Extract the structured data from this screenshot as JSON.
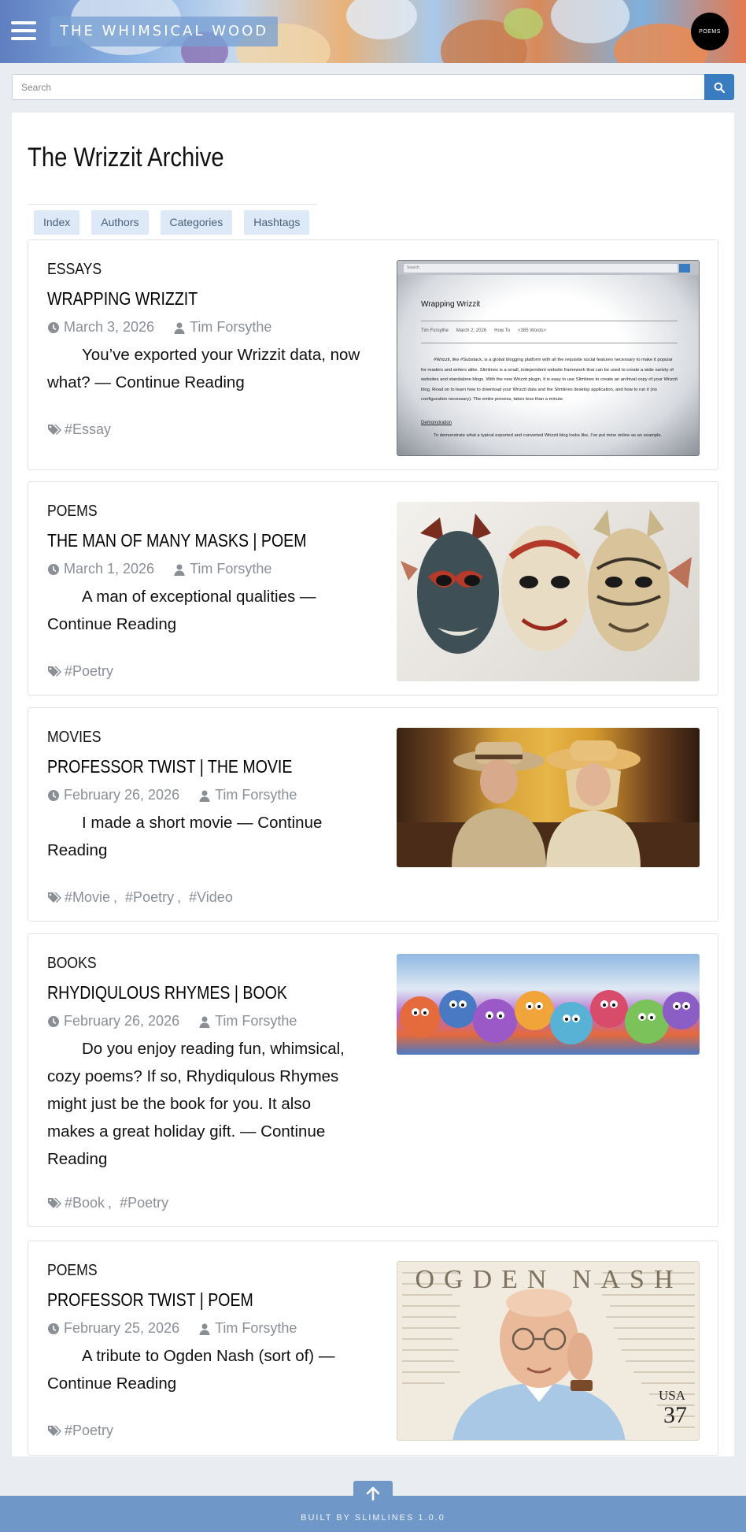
{
  "header": {
    "brand": "THE WHIMSICAL WOOD",
    "poems_button": "POEMS",
    "menu_icon": "hamburger-menu-icon"
  },
  "search": {
    "placeholder": "Search",
    "icon": "search-icon"
  },
  "archive": {
    "title": "The Wrizzit Archive",
    "tabs": [
      "Index",
      "Authors",
      "Categories",
      "Hashtags"
    ]
  },
  "posts": [
    {
      "category": "ESSAYS",
      "title": "WRAPPING WRIZZIT",
      "date": "March 3, 2026",
      "author": "Tim Forsythe",
      "excerpt": "You’ve exported your Wrizzit data, now what? — Continue Reading",
      "tags": [
        "#Essay"
      ],
      "image": {
        "search_placeholder": "Search",
        "title": "Wrapping Wrizzit",
        "meta_author": "Tim Forsythe",
        "meta_date": "March 2, 2026",
        "meta_category": "How To",
        "meta_words": "<385 Words>",
        "body": "#Wrizzit, like #Substack, is a global blogging platform with all the requisite social features necessary to make it popular for readers and writers alike. Slimlines is a small, independent website framework that can be used to create a wide variety of websites and standalone blogs. With the new Wrizzit plugin, it is easy to use Slimlines to create an archival copy of your Wrizzit blog. Read on to learn how to download your Wrizzit data and the Slimlines desktop application, and how to run it (no configuration necessary). The entire process, takes less than a minute.",
        "subhead": "Demonstration",
        "body2": "To demonstrate what a typical exported and converted Wrizzit blog looks like, I’ve put mine online as an example."
      }
    },
    {
      "category": "POEMS",
      "title": "THE MAN OF MANY MASKS | POEM",
      "date": "March 1, 2026",
      "author": "Tim Forsythe",
      "excerpt": "A man of exceptional qualities — Continue Reading",
      "tags": [
        "#Poetry"
      ]
    },
    {
      "category": "MOVIES",
      "title": "PROFESSOR TWIST | THE MOVIE",
      "date": "February 26, 2026",
      "author": "Tim Forsythe",
      "excerpt": "I made a short movie — Continue Reading",
      "tags": [
        "#Movie",
        "#Poetry",
        "#Video"
      ]
    },
    {
      "category": "BOOKS",
      "title": "RHYDIQULOUS RHYMES | BOOK",
      "date": "February 26, 2026",
      "author": "Tim Forsythe",
      "excerpt": "Do you enjoy reading fun, whimsical, cozy poems? If so, Rhydiqulous Rhymes might just be the book for you. It also makes a great holiday gift. — Continue Reading",
      "tags": [
        "#Book",
        "#Poetry"
      ]
    },
    {
      "category": "POEMS",
      "title": "PROFESSOR TWIST | POEM",
      "date": "February 25, 2026",
      "author": "Tim Forsythe",
      "excerpt": "A tribute to Ogden Nash (sort of) — Continue Reading",
      "tags": [
        "#Poetry"
      ],
      "image": {
        "stamp_name": "OGDEN NASH",
        "stamp_country": "USA",
        "stamp_value": "37"
      }
    }
  ],
  "footer": {
    "credit": "BUILT BY SLIMLINES 1.0.0"
  },
  "colors": {
    "accent": "#3a7cc0",
    "footer": "#6f97c8",
    "tab_bg": "#dde9f7",
    "meta_text": "#8a8f96"
  }
}
